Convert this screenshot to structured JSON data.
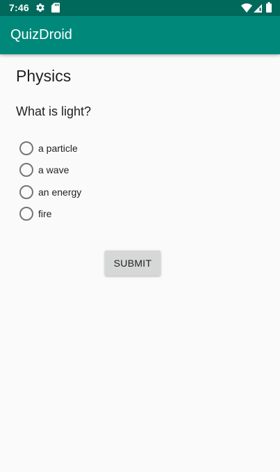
{
  "status_bar": {
    "time": "7:46",
    "icons": [
      "settings-icon",
      "sd-card-icon",
      "wifi-icon",
      "signal-icon",
      "battery-icon"
    ],
    "background": "#00695c"
  },
  "app_bar": {
    "title": "QuizDroid",
    "background": "#00897b"
  },
  "quiz": {
    "category": "Physics",
    "question": "What is light?",
    "options": [
      {
        "label": "a particle",
        "selected": false
      },
      {
        "label": "a wave",
        "selected": false
      },
      {
        "label": "an energy",
        "selected": false
      },
      {
        "label": "fire",
        "selected": false
      }
    ],
    "submit_label": "SUBMIT"
  }
}
